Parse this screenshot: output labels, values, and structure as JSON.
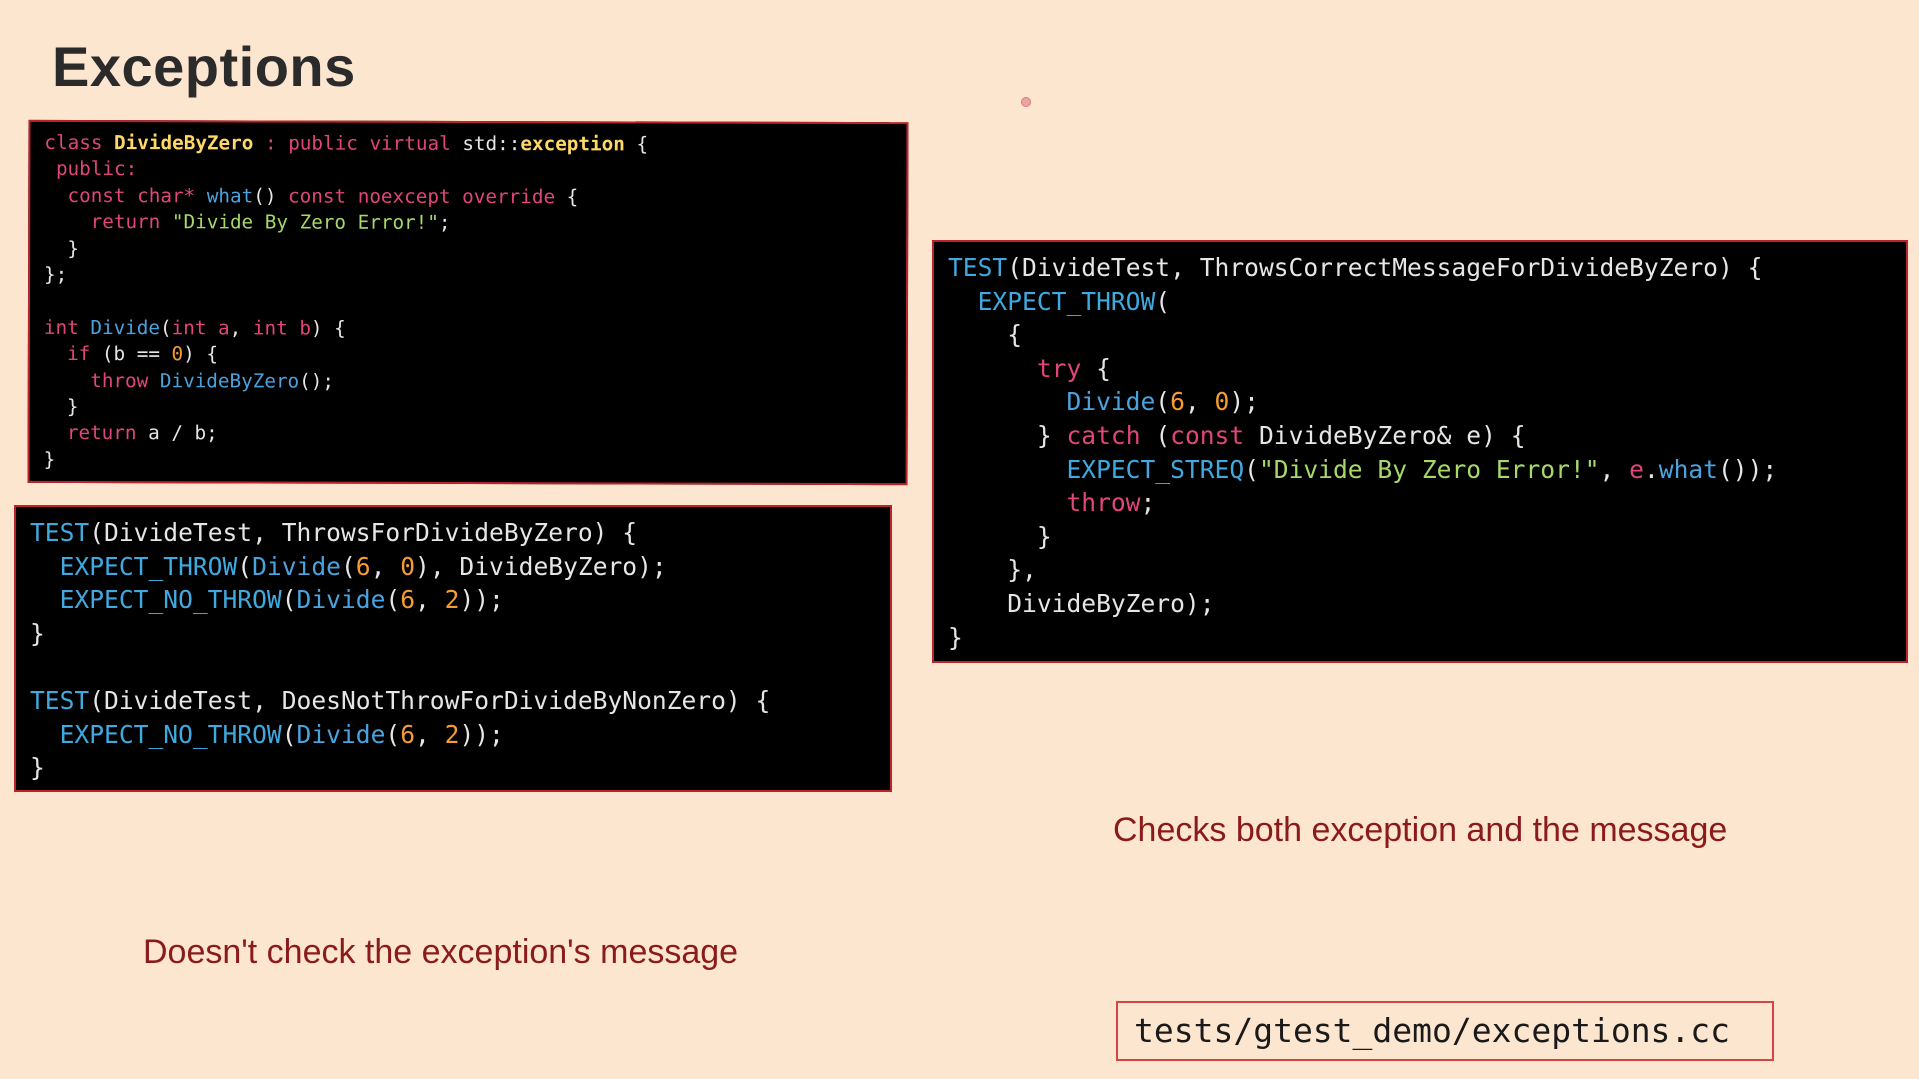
{
  "slide": {
    "title": "Exceptions",
    "note_left": "Doesn't check the exception's message",
    "note_right": "Checks both exception and the message",
    "file_path": "tests/gtest_demo/exceptions.cc"
  },
  "code_blocks": {
    "class_and_divide": [
      [
        [
          "kw",
          "class "
        ],
        [
          "ty",
          "DivideByZero"
        ],
        [
          "kw",
          " : public virtual "
        ],
        [
          "pl",
          "std::"
        ],
        [
          "ty",
          "exception"
        ],
        [
          "pl",
          " {"
        ]
      ],
      [
        [
          "kw",
          " public:"
        ]
      ],
      [
        [
          "kw",
          "  const char* "
        ],
        [
          "fn",
          "what"
        ],
        [
          "pl",
          "() "
        ],
        [
          "kw",
          "const noexcept override"
        ],
        [
          "pl",
          " {"
        ]
      ],
      [
        [
          "kw",
          "    return "
        ],
        [
          "str",
          "\"Divide By Zero Error!\""
        ],
        [
          "pl",
          ";"
        ]
      ],
      [
        [
          "pl",
          "  }"
        ]
      ],
      [
        [
          "pl",
          "};"
        ]
      ],
      [
        [
          "pl",
          ""
        ]
      ],
      [
        [
          "kw",
          "int "
        ],
        [
          "fn",
          "Divide"
        ],
        [
          "pl",
          "("
        ],
        [
          "kw",
          "int "
        ],
        [
          "kw",
          "a"
        ],
        [
          "pl",
          ", "
        ],
        [
          "kw",
          "int "
        ],
        [
          "kw",
          "b"
        ],
        [
          "pl",
          ") {"
        ]
      ],
      [
        [
          "kw",
          "  if "
        ],
        [
          "pl",
          "(b == "
        ],
        [
          "num",
          "0"
        ],
        [
          "pl",
          ") {"
        ]
      ],
      [
        [
          "kw",
          "    throw "
        ],
        [
          "fn",
          "DivideByZero"
        ],
        [
          "pl",
          "();"
        ]
      ],
      [
        [
          "pl",
          "  }"
        ]
      ],
      [
        [
          "kw",
          "  return "
        ],
        [
          "pl",
          "a / b;"
        ]
      ],
      [
        [
          "pl",
          "}"
        ]
      ]
    ],
    "tests_left": [
      [
        [
          "tm",
          "TEST"
        ],
        [
          "pl",
          "(DivideTest, ThrowsForDivideByZero) {"
        ]
      ],
      [
        [
          "tm",
          "  EXPECT_THROW"
        ],
        [
          "pl",
          "("
        ],
        [
          "fn",
          "Divide"
        ],
        [
          "pl",
          "("
        ],
        [
          "num",
          "6"
        ],
        [
          "pl",
          ", "
        ],
        [
          "num",
          "0"
        ],
        [
          "pl",
          "), DivideByZero);"
        ]
      ],
      [
        [
          "tm",
          "  EXPECT_NO_THROW"
        ],
        [
          "pl",
          "("
        ],
        [
          "fn",
          "Divide"
        ],
        [
          "pl",
          "("
        ],
        [
          "num",
          "6"
        ],
        [
          "pl",
          ", "
        ],
        [
          "num",
          "2"
        ],
        [
          "pl",
          "));"
        ]
      ],
      [
        [
          "pl",
          "}"
        ]
      ],
      [
        [
          "pl",
          ""
        ]
      ],
      [
        [
          "tm",
          "TEST"
        ],
        [
          "pl",
          "(DivideTest, DoesNotThrowForDivideByNonZero) {"
        ]
      ],
      [
        [
          "tm",
          "  EXPECT_NO_THROW"
        ],
        [
          "pl",
          "("
        ],
        [
          "fn",
          "Divide"
        ],
        [
          "pl",
          "("
        ],
        [
          "num",
          "6"
        ],
        [
          "pl",
          ", "
        ],
        [
          "num",
          "2"
        ],
        [
          "pl",
          "));"
        ]
      ],
      [
        [
          "pl",
          "}"
        ]
      ]
    ],
    "test_right": [
      [
        [
          "tm",
          "TEST"
        ],
        [
          "pl",
          "(DivideTest, ThrowsCorrectMessageForDivideByZero) {"
        ]
      ],
      [
        [
          "tm",
          "  EXPECT_THROW"
        ],
        [
          "pl",
          "("
        ]
      ],
      [
        [
          "pl",
          "    {"
        ]
      ],
      [
        [
          "kw",
          "      try"
        ],
        [
          "pl",
          " {"
        ]
      ],
      [
        [
          "fn",
          "        Divide"
        ],
        [
          "pl",
          "("
        ],
        [
          "num",
          "6"
        ],
        [
          "pl",
          ", "
        ],
        [
          "num",
          "0"
        ],
        [
          "pl",
          ");"
        ]
      ],
      [
        [
          "pl",
          "      } "
        ],
        [
          "kw",
          "catch"
        ],
        [
          "pl",
          " ("
        ],
        [
          "kw",
          "const"
        ],
        [
          "pl",
          " DivideByZero& e) {"
        ]
      ],
      [
        [
          "tm",
          "        EXPECT_STREQ"
        ],
        [
          "pl",
          "("
        ],
        [
          "str",
          "\"Divide By Zero Error!\""
        ],
        [
          "pl",
          ", "
        ],
        [
          "kw",
          "e"
        ],
        [
          "pl",
          "."
        ],
        [
          "fn",
          "what"
        ],
        [
          "pl",
          "());"
        ]
      ],
      [
        [
          "kw",
          "        throw"
        ],
        [
          "pl",
          ";"
        ]
      ],
      [
        [
          "pl",
          "      }"
        ]
      ],
      [
        [
          "pl",
          "    },"
        ]
      ],
      [
        [
          "pl",
          "    DivideByZero);"
        ]
      ],
      [
        [
          "pl",
          "}"
        ]
      ]
    ]
  },
  "colors": {
    "background": "#fde6d0",
    "box_border": "#b8262c",
    "note_text": "#8b1a1a",
    "keyword": "#e0457b",
    "type_name": "#ffd866",
    "function": "#4aa3df",
    "string": "#a6d96a",
    "number": "#f59d32"
  }
}
